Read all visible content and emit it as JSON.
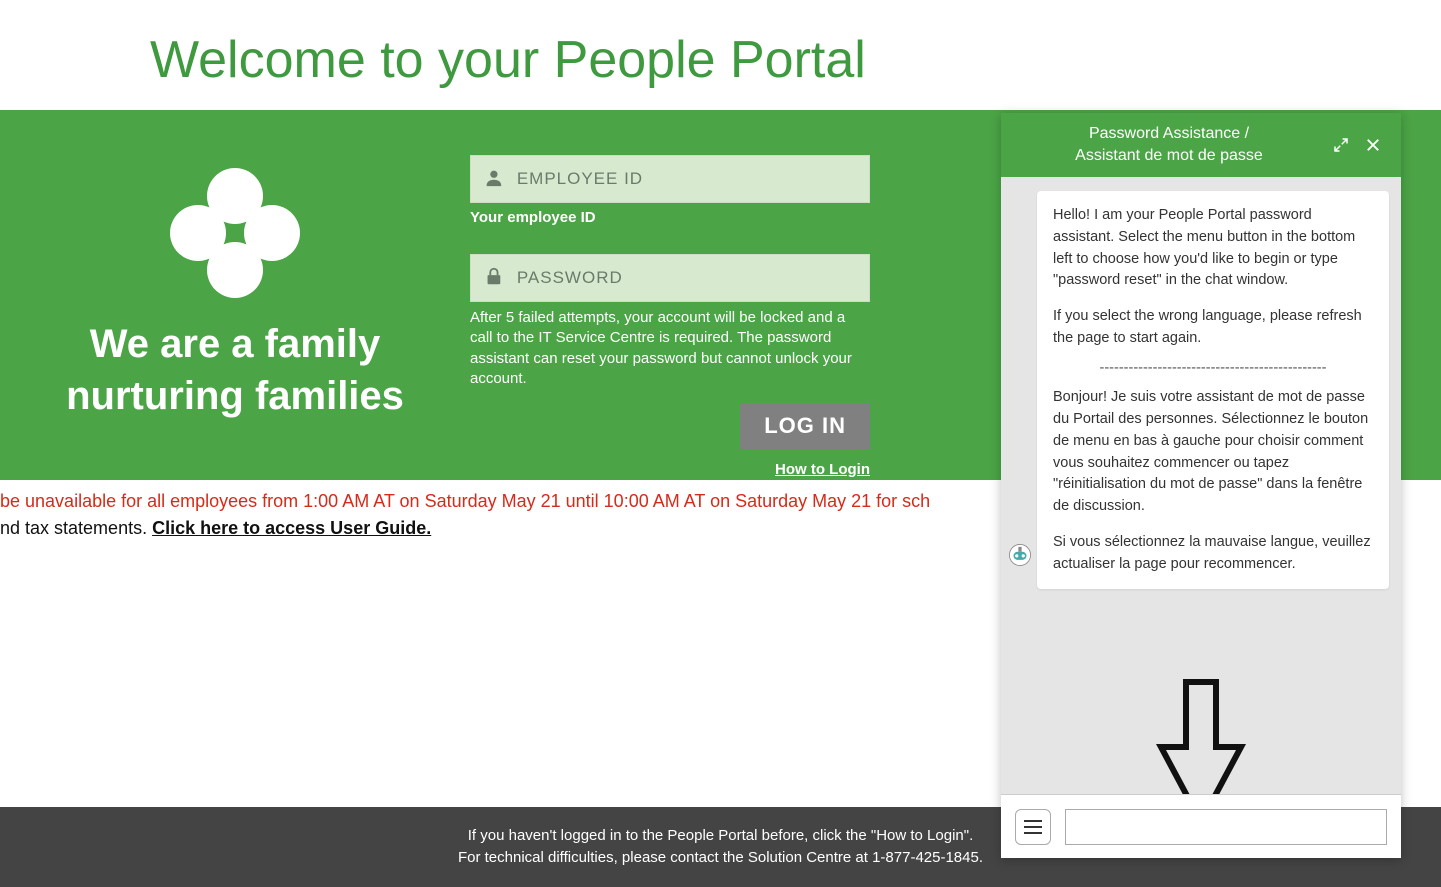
{
  "page": {
    "title": "Welcome to your People Portal",
    "tagline": "We are a family nurturing families"
  },
  "login": {
    "employee_placeholder": "EMPLOYEE ID",
    "employee_hint": "Your employee ID",
    "password_placeholder": "PASSWORD",
    "warning": "After 5 failed attempts, your account will be locked and a call to the IT Service Centre is required. The password assistant can reset your password but cannot unlock your account.",
    "button": "LOG IN",
    "howto": "How to Login"
  },
  "banner": {
    "line1": "be unavailable for all employees from 1:00 AM AT on Saturday May 21 until 10:00 AM AT on Saturday May 21 for sch",
    "line2_prefix": "nd tax statements. ",
    "line2_link": "Click here to access User Guide."
  },
  "footer": {
    "line1": "If you haven't logged in to the People Portal before, click the \"How to Login\".",
    "line2": "For technical difficulties, please contact the Solution Centre at 1-877-425-1845."
  },
  "chat": {
    "title_line1": "Password Assistance /",
    "title_line2": "Assistant de mot de passe",
    "msg_en_p1": "Hello! I am your People Portal password assistant. Select the menu button in the bottom left to choose how you'd like to begin or type \"password reset\" in the chat window.",
    "msg_en_p2": "If you select the wrong language, please refresh the page to start again.",
    "separator": "-----------------------------------------------",
    "msg_fr_p1": "Bonjour! Je suis votre assistant de mot de passe du Portail des personnes. Sélectionnez le bouton de menu en bas à gauche pour choisir comment vous souhaitez commencer ou tapez \"réinitialisation du mot de passe\" dans la fenêtre de discussion.",
    "msg_fr_p2": "Si vous sélectionnez la mauvaise langue, veuillez actualiser la page pour recommencer.",
    "input_placeholder": ""
  }
}
